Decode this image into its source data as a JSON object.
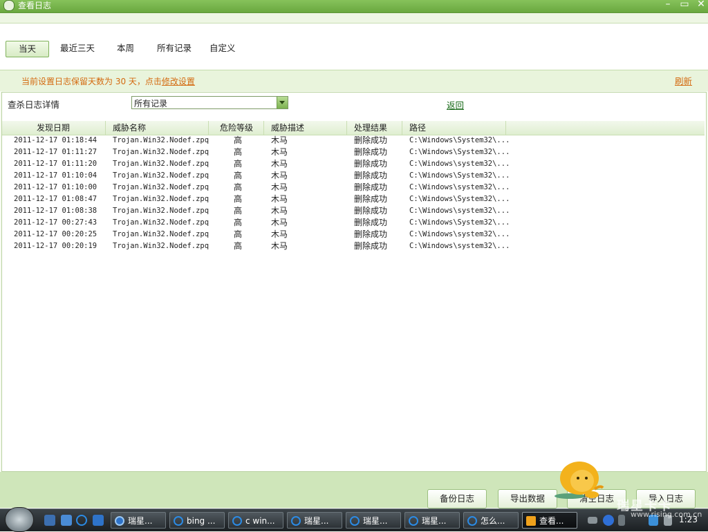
{
  "window": {
    "title": "查看日志",
    "minimize": "–",
    "restore": "▭",
    "close": "✕"
  },
  "tabs": [
    {
      "label": "当天",
      "active": true
    },
    {
      "label": "最近三天"
    },
    {
      "label": "本周"
    },
    {
      "label": "所有记录"
    },
    {
      "label": "自定义"
    }
  ],
  "notice": {
    "prefix": "当前设置日志保留天数为 30 天，点击",
    "link": "修改设置",
    "refresh": "刷新"
  },
  "panel": {
    "heading": "查杀日志详情",
    "filter_value": "所有记录",
    "back": "返回"
  },
  "table": {
    "columns": [
      "发现日期",
      "威胁名称",
      "危险等级",
      "威胁描述",
      "处理结果",
      "路径"
    ],
    "rows": [
      [
        "2011-12-17 01:18:44",
        "Trojan.Win32.Nodef.zpq",
        "高",
        "木马",
        "删除成功",
        "C:\\Windows\\System32\\..."
      ],
      [
        "2011-12-17 01:11:27",
        "Trojan.Win32.Nodef.zpq",
        "高",
        "木马",
        "删除成功",
        "C:\\Windows\\System32\\..."
      ],
      [
        "2011-12-17 01:11:20",
        "Trojan.Win32.Nodef.zpq",
        "高",
        "木马",
        "删除成功",
        "C:\\Windows\\system32\\..."
      ],
      [
        "2011-12-17 01:10:04",
        "Trojan.Win32.Nodef.zpq",
        "高",
        "木马",
        "删除成功",
        "C:\\Windows\\System32\\..."
      ],
      [
        "2011-12-17 01:10:00",
        "Trojan.Win32.Nodef.zpq",
        "高",
        "木马",
        "删除成功",
        "C:\\Windows\\system32\\..."
      ],
      [
        "2011-12-17 01:08:47",
        "Trojan.Win32.Nodef.zpq",
        "高",
        "木马",
        "删除成功",
        "C:\\Windows\\System32\\..."
      ],
      [
        "2011-12-17 01:08:38",
        "Trojan.Win32.Nodef.zpq",
        "高",
        "木马",
        "删除成功",
        "C:\\Windows\\system32\\..."
      ],
      [
        "2011-12-17 00:27:43",
        "Trojan.Win32.Nodef.zpq",
        "高",
        "木马",
        "删除成功",
        "C:\\Windows\\System32\\..."
      ],
      [
        "2011-12-17 00:20:25",
        "Trojan.Win32.Nodef.zpq",
        "高",
        "木马",
        "删除成功",
        "C:\\Windows\\system32\\..."
      ],
      [
        "2011-12-17 00:20:19",
        "Trojan.Win32.Nodef.zpq",
        "高",
        "木马",
        "删除成功",
        "C:\\Windows\\system32\\..."
      ]
    ]
  },
  "buttons": {
    "backup": "备份日志",
    "export": "导出数据",
    "clear": "清空日志",
    "import": "导入日志"
  },
  "taskbar": {
    "tasks": [
      {
        "label": "瑞星...",
        "icon": "rising-icon"
      },
      {
        "label": "bing ...",
        "icon": "ie-icon"
      },
      {
        "label": "c win...",
        "icon": "ie-icon"
      },
      {
        "label": "瑞星...",
        "icon": "ie-icon"
      },
      {
        "label": "瑞星...",
        "icon": "ie-icon"
      },
      {
        "label": "瑞星...",
        "icon": "ie-icon"
      },
      {
        "label": "怎么...",
        "icon": "ie-icon"
      },
      {
        "label": "查看...",
        "icon": "log-icon",
        "active": true
      }
    ],
    "clock": "1:23"
  },
  "watermark": {
    "main": "瑞星卡卡",
    "sub": "www.rising.com.cn"
  }
}
